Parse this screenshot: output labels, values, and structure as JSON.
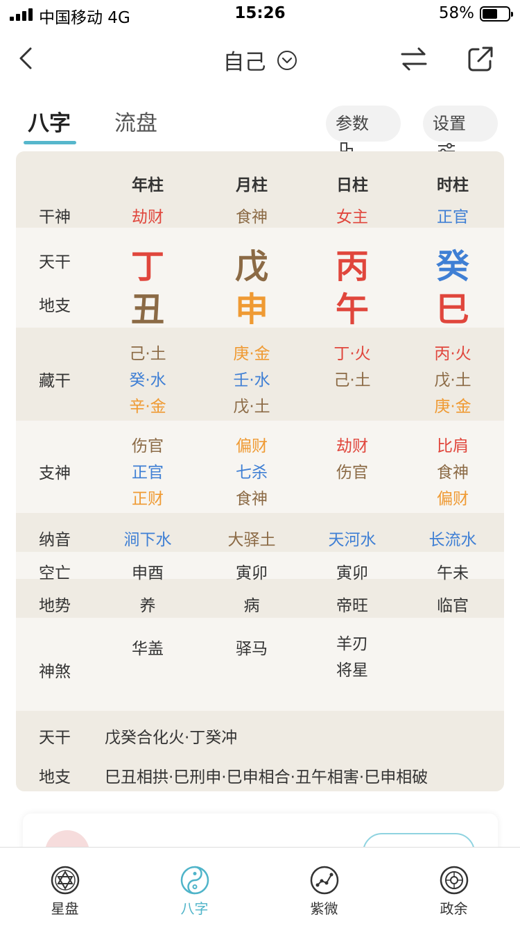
{
  "status_bar": {
    "carrier": "中国移动  4G",
    "time": "15:26",
    "battery": "58%",
    "battery_level": 0.58
  },
  "nav": {
    "title": "自己"
  },
  "tabs": [
    {
      "label": "八字",
      "active": true
    },
    {
      "label": "流盘",
      "active": false
    }
  ],
  "buttons": {
    "params": "参数",
    "settings": "设置"
  },
  "chart": {
    "columns": [
      "年柱",
      "月柱",
      "日柱",
      "时柱"
    ],
    "gan_shen": {
      "label": "干神",
      "values": [
        "劫财",
        "食神",
        "女主",
        "正官"
      ]
    },
    "tian_gan": {
      "label": "天干",
      "values": [
        "丁",
        "戊",
        "丙",
        "癸"
      ]
    },
    "di_zhi": {
      "label": "地支",
      "values": [
        "丑",
        "申",
        "午",
        "巳"
      ]
    },
    "zang_gan": {
      "label": "藏干",
      "values": [
        [
          "己·土",
          "癸·水",
          "辛·金"
        ],
        [
          "庚·金",
          "壬·水",
          "戊·土"
        ],
        [
          "丁·火",
          "己·土"
        ],
        [
          "丙·火",
          "戊·土",
          "庚·金"
        ]
      ]
    },
    "zhi_shen": {
      "label": "支神",
      "values": [
        [
          "伤官",
          "正官",
          "正财"
        ],
        [
          "偏财",
          "七杀",
          "食神"
        ],
        [
          "劫财",
          "伤官"
        ],
        [
          "比肩",
          "食神",
          "偏财"
        ]
      ]
    },
    "na_yin": {
      "label": "纳音",
      "values": [
        "涧下水",
        "大驿土",
        "天河水",
        "长流水"
      ]
    },
    "kong_wang": {
      "label": "空亡",
      "values": [
        "申酉",
        "寅卯",
        "寅卯",
        "午未"
      ]
    },
    "di_shi": {
      "label": "地势",
      "values": [
        "养",
        "病",
        "帝旺",
        "临官"
      ]
    },
    "shen_sha": {
      "label": "神煞",
      "values": [
        [
          "华盖"
        ],
        [
          "驿马"
        ],
        [
          "羊刃",
          "将星"
        ],
        []
      ]
    },
    "relations": [
      {
        "label": "天干",
        "text": "戊癸合化火·丁癸冲"
      },
      {
        "label": "地支",
        "text": "巳丑相拱·巳刑申·巳申相合·丑午相害·巳申相破"
      }
    ]
  },
  "bottom_tabs": [
    {
      "label": "星盘",
      "icon": "star-of-david-icon",
      "active": false
    },
    {
      "label": "八字",
      "icon": "yin-yang-icon",
      "active": true
    },
    {
      "label": "紫微",
      "icon": "constellation-icon",
      "active": false
    },
    {
      "label": "政余",
      "icon": "compass-wheel-icon",
      "active": false
    }
  ],
  "colors": {
    "accent": "#56b7cc",
    "fire": "#e0463c",
    "earth": "#8b6a45",
    "metal": "#ef9a33",
    "water": "#3f7fd4",
    "text": "#333333",
    "band": "#efebe3",
    "card": "#f7f5f1"
  }
}
